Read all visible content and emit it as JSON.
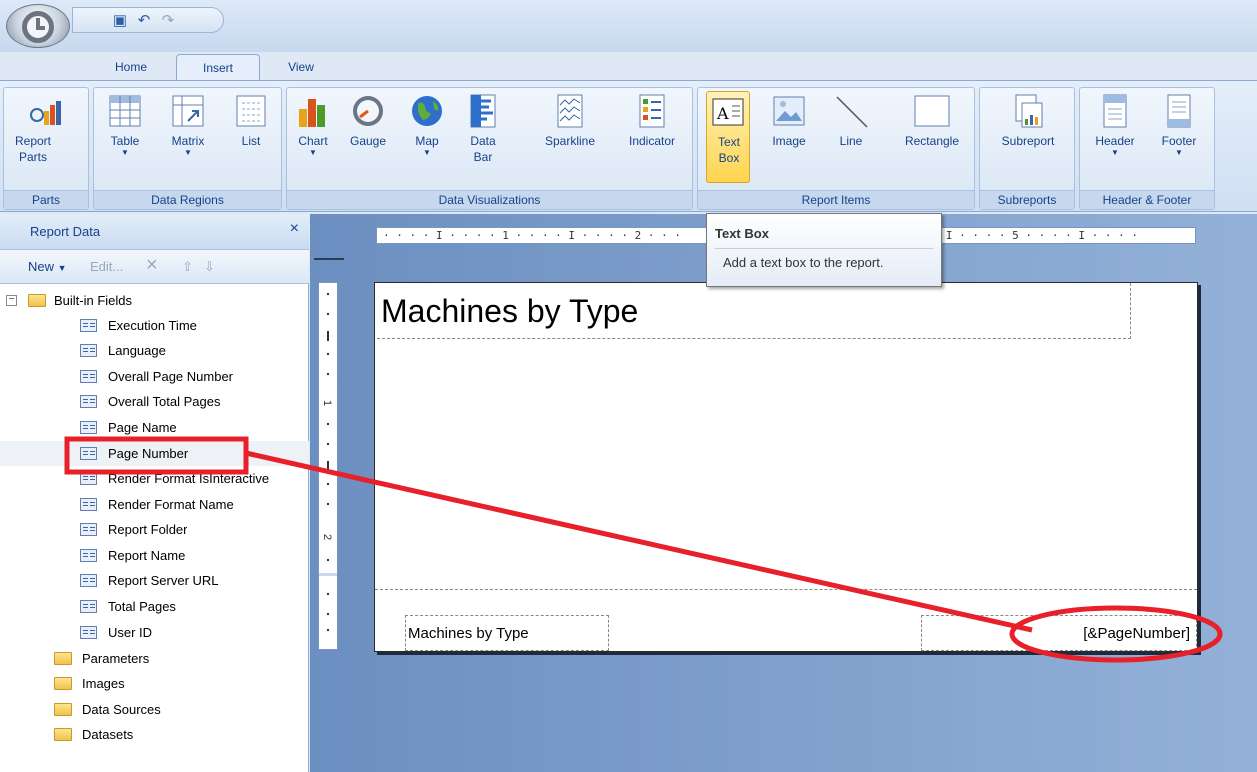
{
  "quick_access": {
    "save_icon": "save-icon",
    "undo_icon": "undo-icon",
    "redo_icon": "redo-icon"
  },
  "tabs": [
    {
      "label": "Home"
    },
    {
      "label": "Insert",
      "selected": true
    },
    {
      "label": "View"
    }
  ],
  "ribbon": {
    "groups": [
      {
        "label": "Parts",
        "buttons": [
          {
            "label": "Report Parts",
            "icon": "report-parts-icon"
          }
        ]
      },
      {
        "label": "Data Regions",
        "buttons": [
          {
            "label": "Table",
            "icon": "table-icon",
            "dropdown": true
          },
          {
            "label": "Matrix",
            "icon": "matrix-icon",
            "dropdown": true
          },
          {
            "label": "List",
            "icon": "list-icon"
          }
        ]
      },
      {
        "label": "Data Visualizations",
        "buttons": [
          {
            "label": "Chart",
            "icon": "chart-icon",
            "dropdown": true
          },
          {
            "label": "Gauge",
            "icon": "gauge-icon"
          },
          {
            "label": "Map",
            "icon": "map-icon",
            "dropdown": true
          },
          {
            "label": "Data Bar",
            "icon": "data-bar-icon"
          },
          {
            "label": "Sparkline",
            "icon": "sparkline-icon"
          },
          {
            "label": "Indicator",
            "icon": "indicator-icon"
          }
        ]
      },
      {
        "label": "Report Items",
        "buttons": [
          {
            "label": "Text Box",
            "icon": "text-box-icon",
            "active": true
          },
          {
            "label": "Image",
            "icon": "image-icon"
          },
          {
            "label": "Line",
            "icon": "line-icon"
          },
          {
            "label": "Rectangle",
            "icon": "rectangle-icon"
          }
        ]
      },
      {
        "label": "Subreports",
        "buttons": [
          {
            "label": "Subreport",
            "icon": "subreport-icon"
          }
        ]
      },
      {
        "label": "Header & Footer",
        "buttons": [
          {
            "label": "Header",
            "icon": "header-icon",
            "dropdown": true
          },
          {
            "label": "Footer",
            "icon": "footer-icon",
            "dropdown": true
          }
        ]
      }
    ]
  },
  "report_data": {
    "title": "Report Data",
    "close_glyph": "×",
    "toolbar": {
      "new": "New",
      "edit": "Edit...",
      "delete_glyph": "×",
      "up_glyph": "⇧",
      "down_glyph": "⇩"
    },
    "root_expander": "−",
    "tree": [
      {
        "label": "Built-in Fields",
        "type": "folder",
        "expanded": true
      },
      {
        "label": "Execution Time",
        "type": "field"
      },
      {
        "label": "Language",
        "type": "field"
      },
      {
        "label": "Overall Page Number",
        "type": "field"
      },
      {
        "label": "Overall Total Pages",
        "type": "field"
      },
      {
        "label": "Page Name",
        "type": "field"
      },
      {
        "label": "Page Number",
        "type": "field",
        "highlighted": true
      },
      {
        "label": "Render Format IsInteractive",
        "type": "field"
      },
      {
        "label": "Render Format Name",
        "type": "field"
      },
      {
        "label": "Report Folder",
        "type": "field"
      },
      {
        "label": "Report Name",
        "type": "field"
      },
      {
        "label": "Report Server URL",
        "type": "field"
      },
      {
        "label": "Total Pages",
        "type": "field"
      },
      {
        "label": "User ID",
        "type": "field"
      },
      {
        "label": "Parameters",
        "type": "folder"
      },
      {
        "label": "Images",
        "type": "folder"
      },
      {
        "label": "Data Sources",
        "type": "folder"
      },
      {
        "label": "Datasets",
        "type": "folder"
      }
    ]
  },
  "ruler": {
    "horizontal": "· · · · I · · · · 1 · · · · I · · · · 2 · · ·                                  · · · I · · · · 5 · · · · I · · · ·",
    "vertical_marks": [
      "1",
      "2"
    ]
  },
  "report": {
    "title": "Machines by Type",
    "footer_left": "Machines by Type",
    "footer_right": "[&PageNumber]"
  },
  "tooltip": {
    "title": "Text Box",
    "description": "Add a text box to the report."
  },
  "colors": {
    "annotation": "#e8202a",
    "highlight_button": "#ffd44f",
    "ribbon": "#dbe7f5"
  }
}
